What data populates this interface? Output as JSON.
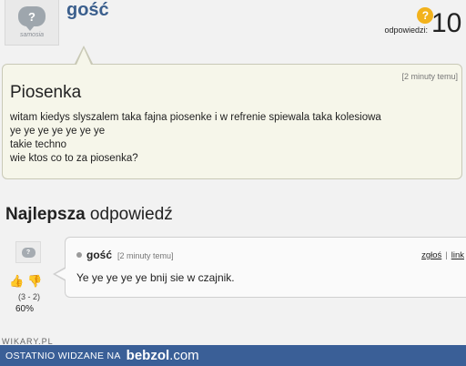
{
  "question": {
    "avatar_text": "?",
    "avatar_brand": "samosia",
    "username": "gość",
    "answers_label": "odpowiedzi:",
    "answers_count": "10",
    "time": "[2 minuty temu]",
    "title": "Piosenka",
    "body_lines": [
      "witam kiedys slyszalem taka fajna piosenke i w refrenie spiewala taka kolesiowa",
      "ye ye ye ye ye ye ye",
      "takie techno",
      "wie ktos co to za piosenka?"
    ]
  },
  "best_answer": {
    "heading_bold": "Najlepsza",
    "heading_rest": " odpowiedź",
    "avatar_text": "?",
    "votes_counts": "(3 - 2)",
    "votes_percent": "60%",
    "username": "gość",
    "time": "[2 minuty temu]",
    "report_label": "zgłoś",
    "link_label": "link",
    "text": "Ye ye ye ye ye bnij sie w czajnik."
  },
  "watermark": "WIKARY.PL",
  "footer": {
    "text": "OSTATNIO WIDZANE NA",
    "logo_main": "bebzol",
    "logo_domain": ".com"
  },
  "colors": {
    "username": "#3b5f8d",
    "footer_bg": "#3a5f97",
    "answers_icon": "#f2b21c"
  }
}
